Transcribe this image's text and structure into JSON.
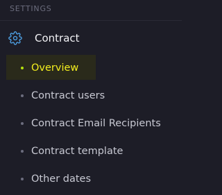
{
  "section": {
    "title": "SETTINGS"
  },
  "group": {
    "label": "Contract",
    "icon": "gear-icon",
    "icon_color": "#4fa3e8"
  },
  "items": [
    {
      "label": "Overview",
      "active": true
    },
    {
      "label": "Contract users",
      "active": false
    },
    {
      "label": "Contract Email Recipients",
      "active": false
    },
    {
      "label": "Contract template",
      "active": false
    },
    {
      "label": "Other dates",
      "active": false
    }
  ],
  "colors": {
    "background": "#1d1d27",
    "active_text": "#f4ef1e",
    "active_dot": "#b5e10c",
    "active_highlight": "#2a2a1b",
    "text": "#c8c9d3",
    "muted": "#6c6d7e"
  }
}
